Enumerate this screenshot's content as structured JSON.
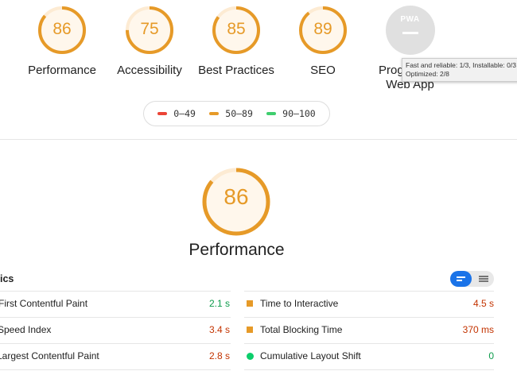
{
  "categories": [
    {
      "score": "86",
      "label": "Performance"
    },
    {
      "score": "75",
      "label": "Accessibility"
    },
    {
      "score": "85",
      "label": "Best Practices"
    },
    {
      "score": "89",
      "label": "SEO"
    }
  ],
  "pwa": {
    "badge": "PWA",
    "label_line1": "Prog",
    "label_line2": "Web App"
  },
  "tooltip": {
    "line1": "Fast and reliable: 1/3, Installable: 0/3",
    "line2": "Optimized: 2/8"
  },
  "legend": [
    {
      "range": "0–49",
      "color": "#eb4436"
    },
    {
      "range": "50–89",
      "color": "#e69a28"
    },
    {
      "range": "90–100",
      "color": "#3fce6e"
    }
  ],
  "main": {
    "score": "86",
    "title": "Performance",
    "score_color": "#e69a28"
  },
  "metrics": {
    "heading": "ics",
    "left": [
      {
        "name": "First Contentful Paint",
        "value": "2.1 s",
        "color": "#0c9b4b"
      },
      {
        "name": "Speed Index",
        "value": "3.4 s",
        "color": "#c33300"
      },
      {
        "name": "Largest Contentful Paint",
        "value": "2.8 s",
        "color": "#c33300"
      }
    ],
    "right": [
      {
        "name": "Time to Interactive",
        "value": "4.5 s",
        "color": "#c33300"
      },
      {
        "name": "Total Blocking Time",
        "value": "370 ms",
        "color": "#c33300"
      },
      {
        "name": "Cumulative Layout Shift",
        "value": "0",
        "color": "#0c9b4b"
      }
    ]
  }
}
